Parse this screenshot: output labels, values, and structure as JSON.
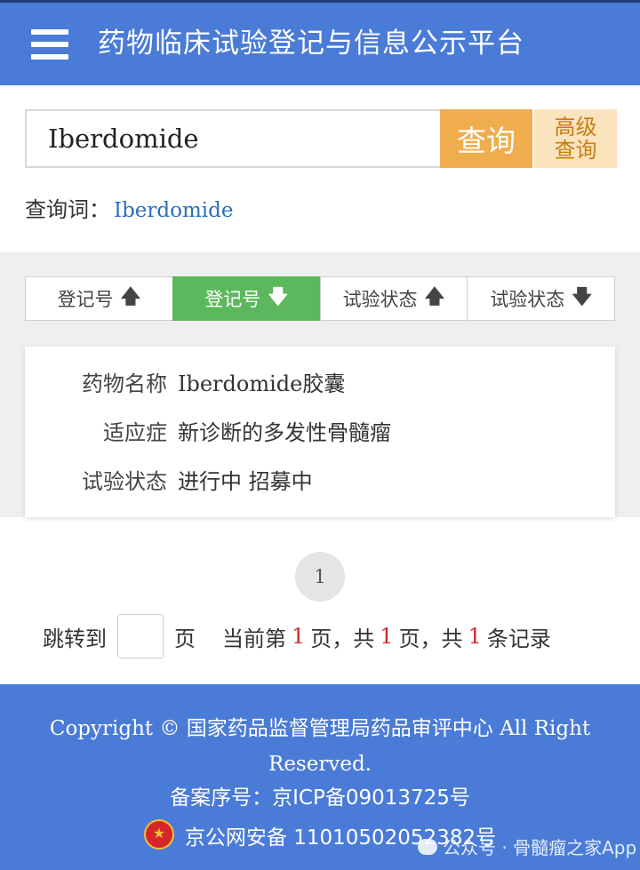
{
  "header": {
    "title": "药物临床试验登记与信息公示平台"
  },
  "search": {
    "value": "Iberdomide",
    "search_button": "查询",
    "advanced_line1": "高级",
    "advanced_line2": "查询"
  },
  "query": {
    "label": "查询词：",
    "term": "Iberdomide"
  },
  "sort": {
    "items": [
      {
        "label": "登记号",
        "arrow": "🡅",
        "icon": "arrow-up-icon",
        "active": false
      },
      {
        "label": "登记号",
        "arrow": "🡇",
        "icon": "arrow-down-icon",
        "active": true
      },
      {
        "label": "试验状态",
        "arrow": "🡅",
        "icon": "arrow-up-icon",
        "active": false
      },
      {
        "label": "试验状态",
        "arrow": "🡇",
        "icon": "arrow-down-icon",
        "active": false
      }
    ]
  },
  "result": {
    "drug_label": "药物名称",
    "drug_value_latin": "Iberdomide",
    "drug_value_cn": "胶囊",
    "indication_label": "适应症",
    "indication_value": "新诊断的多发性骨髓瘤",
    "status_label": "试验状态",
    "status_value": "进行中 招募中"
  },
  "pagination": {
    "current_page": "1",
    "jump_label": "跳转到",
    "page_unit": "页",
    "current_prefix": "当前第",
    "current_num": "1",
    "mid1": "页，共",
    "total_pages": "1",
    "mid2": "页，共",
    "total_records": "1",
    "records_suffix": "条记录"
  },
  "footer": {
    "copyright": "Copyright © 国家药品监督管理局药品审评中心 All Right Reserved.",
    "icp": "备案序号：京ICP备09013725号",
    "police": "京公网安备 11010502052382号"
  },
  "watermark": {
    "text": "公众号 · 骨髓瘤之家App"
  },
  "colors": {
    "header_bg": "#4a7bd6",
    "search_button": "#f0ad4e",
    "advanced_button": "#fbe3bd",
    "active_sort": "#5cb85c",
    "highlight_red": "#d0262b"
  }
}
